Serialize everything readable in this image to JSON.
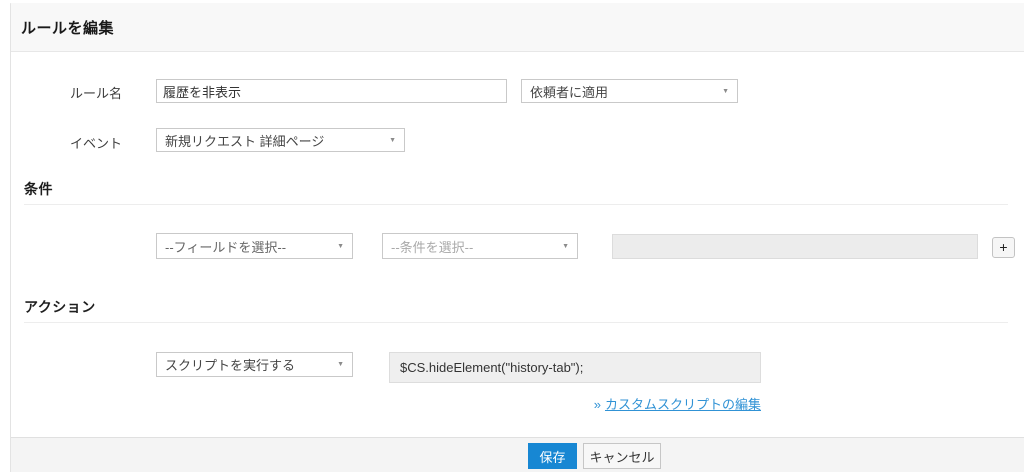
{
  "page": {
    "title": "ルールを編集"
  },
  "rule": {
    "name_label": "ルール名",
    "name_value": "履歴を非表示",
    "apply_to_value": "依頼者に適用",
    "event_label": "イベント",
    "event_value": "新規リクエスト 詳細ページ"
  },
  "conditions": {
    "heading": "条件",
    "field_placeholder": "--フィールドを選択--",
    "criteria_placeholder": "--条件を選択--",
    "value": "",
    "add_label": "+"
  },
  "actions": {
    "heading": "アクション",
    "type_value": "スクリプトを実行する",
    "script_value": "$CS.hideElement(\"history-tab\");",
    "link_prefix": "»",
    "link_label": "カスタムスクリプトの編集"
  },
  "footer": {
    "save": "保存",
    "cancel": "キャンセル"
  },
  "icons": {
    "dropdown_arrow": "▼"
  },
  "colors": {
    "accent": "#1787d3",
    "link": "#3092d5"
  }
}
